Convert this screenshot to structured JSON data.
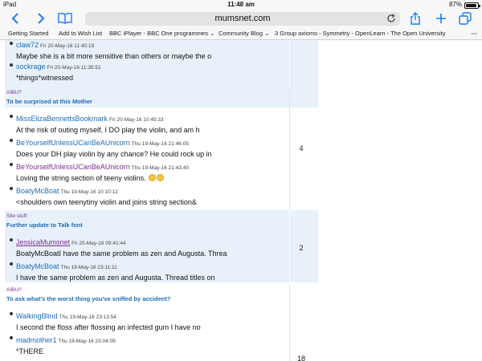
{
  "status": {
    "device": "iPad",
    "time": "11:48 am",
    "battery": "87%",
    "battery_level": 0.87
  },
  "toolbar": {
    "url": "mumsnet.com",
    "icons": [
      "back-icon",
      "forward-icon",
      "bookmarks-icon",
      "reload-icon",
      "share-icon",
      "new-tab-icon",
      "tabs-icon"
    ]
  },
  "bookmarks": {
    "items": [
      "Getting Started",
      "Add to Wish List",
      "BBC iPlayer - BBC One programmes",
      "Community Blog",
      "3 Group axioms - Symmetry - OpenLearn - The Open University"
    ],
    "more": "⋯"
  },
  "threads": [
    {
      "posts": [
        {
          "author": "claw72",
          "date": "Fri 20-May-16 11:40:18",
          "text": "Maybe she is a bit more sensitive than others or maybe the o"
        },
        {
          "author": "sockrage",
          "date": "Fri 20-May-16 11:35:51",
          "text": "*things*witnessed"
        }
      ]
    },
    {
      "category": "AIBU?",
      "title": "To be surprised at this Mother",
      "count": "4",
      "posts": [
        {
          "author": "MissElizaBennettsBookmark",
          "date": "Fri 20-May-16 10:45:33",
          "text": "At the risk of outing myself, I DO play the violin, and am h"
        },
        {
          "author": "BeYourselfUnlessUCanBeAUnicorn",
          "date": "Thu 19-May-16 21:46:05",
          "text": "Does your DH play violin by any chance? He could rock up in"
        },
        {
          "author": "BeYourselfUnlessUCanBeAUnicorn",
          "date": "Thu 19-May-16 21:43:40",
          "text": "Loving the string section of teeny violins."
        },
        {
          "author": "BoatyMcBoat",
          "date": "Thu 19-May-16 10:10:12",
          "text": "<shoulders own teenytiny violin and joins string section&"
        }
      ]
    },
    {
      "category": "Site stuff",
      "title": "Further update to Talk font",
      "count": "2",
      "posts": [
        {
          "author": "JessicaMumsnet",
          "date": "Fri 20-May-16 09:41:44",
          "text": "BoatyMcBoatI have the same problem as zen and Augusta. Threa"
        },
        {
          "author": "BoatyMcBoat",
          "date": "Thu 19-May-16 23:11:11",
          "text": "I have the same problem as zen and Augusta. Thread titles on"
        }
      ]
    },
    {
      "category": "AIBU?",
      "title": "To ask what's the worst thing you've sniffed by accident?",
      "count": "18",
      "posts": [
        {
          "author": "WalkingBlind",
          "date": "Thu 19-May-16 23:13:54",
          "text": "I second the floss after flossing an infected gum I have no"
        },
        {
          "author": "madmother1",
          "date": "Thu 19-May-16 23:04:09",
          "text": "*THERE"
        }
      ]
    }
  ]
}
